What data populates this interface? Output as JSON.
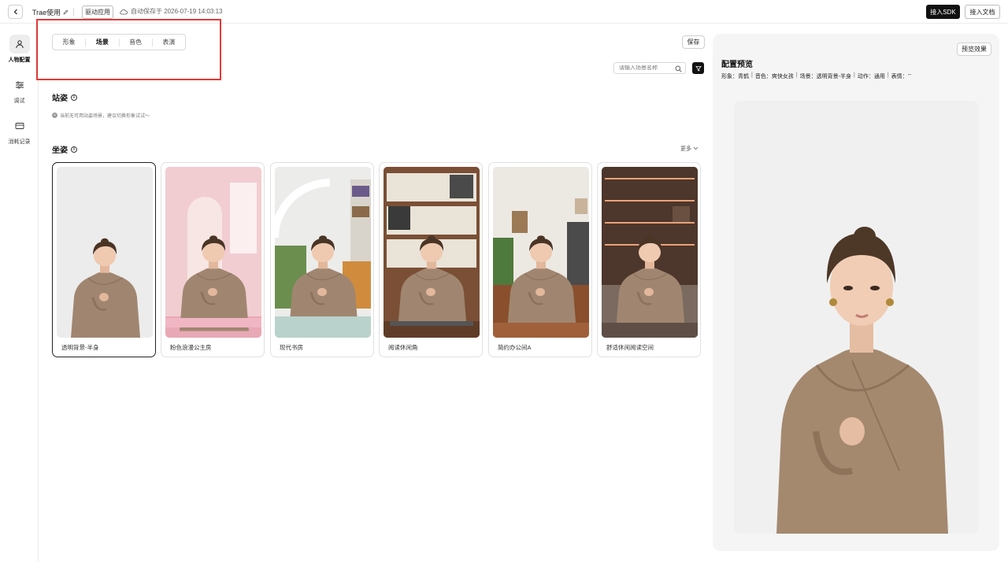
{
  "header": {
    "app_name": "Trae使用",
    "tag": "驱动应用",
    "autosave": "自动保存于 2026-07-19 14:03:13",
    "sdk_button": "接入SDK",
    "docs_button": "接入文档"
  },
  "sidebar": {
    "items": [
      {
        "label": "人物配置",
        "icon": "person-icon",
        "active": true
      },
      {
        "label": "调试",
        "icon": "sliders-icon",
        "active": false
      },
      {
        "label": "消耗记录",
        "icon": "card-icon",
        "active": false
      }
    ]
  },
  "tabs": [
    "形象",
    "场景",
    "音色",
    "表演"
  ],
  "active_tab": "场景",
  "save_label": "保存",
  "search": {
    "placeholder": "请输入场景名称"
  },
  "standing": {
    "title": "站姿",
    "notice": "当前无可用站姿场景，建议切换形象试试～"
  },
  "sitting": {
    "title": "坐姿",
    "more": "更多",
    "cards": [
      {
        "label": "透明背景-半身",
        "selected": true
      },
      {
        "label": "粉色浪漫公主房",
        "selected": false
      },
      {
        "label": "现代书房",
        "selected": false
      },
      {
        "label": "阅读休闲角",
        "selected": false
      },
      {
        "label": "简约办公间A",
        "selected": false
      },
      {
        "label": "舒适休闲阅读空间",
        "selected": false
      }
    ]
  },
  "preview": {
    "button": "预览效果",
    "title": "配置预览",
    "info": [
      {
        "key": "形象：",
        "value": "青鹤"
      },
      {
        "key": "音色：",
        "value": "爽快女孩"
      },
      {
        "key": "场景：",
        "value": "透明背景-半身"
      },
      {
        "key": "动作：",
        "value": "通用"
      },
      {
        "key": "表情：",
        "value": "--"
      }
    ]
  },
  "colors": {
    "accent": "#111111",
    "highlight": "#e03a3a",
    "panel": "#f5f5f5"
  }
}
